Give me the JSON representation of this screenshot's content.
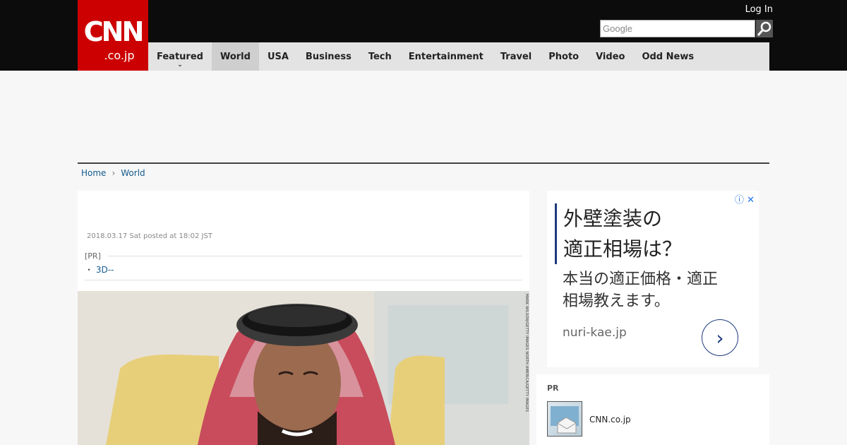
{
  "header": {
    "logo_main": "CNN",
    "logo_sub": ".co.jp",
    "login_label": "Log In",
    "search_placeholder": "Google"
  },
  "nav": {
    "items": [
      {
        "label": "Featured"
      },
      {
        "label": "World"
      },
      {
        "label": "USA"
      },
      {
        "label": "Business"
      },
      {
        "label": "Tech"
      },
      {
        "label": "Entertainment"
      },
      {
        "label": "Travel"
      },
      {
        "label": "Photo"
      },
      {
        "label": "Video"
      },
      {
        "label": "Odd News"
      }
    ],
    "active": "World"
  },
  "breadcrumb": {
    "home": "Home",
    "section": "World"
  },
  "article": {
    "date": "2018.03.17 Sat posted at 18:02 JST",
    "pr_label": "[PR]",
    "pr_bullet": "・",
    "pr_link": "3D--",
    "photo_credit": "MARK WILSON/GETTY IMAGES NORTH AMERICA/GETTY IMAGES"
  },
  "sidebar_ad": {
    "title_line1": "外壁塗装の",
    "title_line2": "適正相場は？",
    "body_line1": "本当の適正価格・適正",
    "body_line2": "相場教えます。",
    "domain": "nuri-kae.jp",
    "arrow": "›",
    "info_icon": "ⓘ",
    "close_icon": "✕"
  },
  "pr_panel": {
    "label": "PR",
    "site_name": "CNN.co.jp"
  },
  "colors": {
    "brand_red": "#cc0000",
    "topbar": "#0c0c0c",
    "nav_bg": "#e3e3e3",
    "link_blue": "#145a8c",
    "ad_navy": "#1d3a7d"
  }
}
